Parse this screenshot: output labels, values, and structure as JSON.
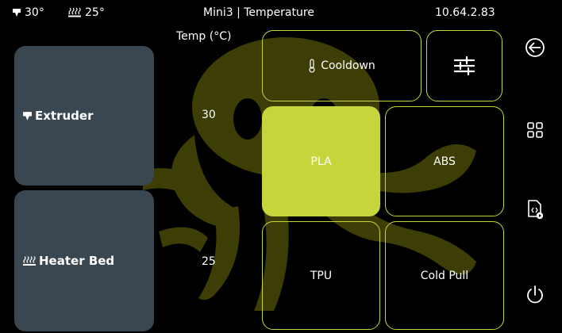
{
  "topbar": {
    "extruder_temp": "30°",
    "bed_temp": "25°",
    "title": "Mini3 | Temperature",
    "ip": "10.64.2.83"
  },
  "heaters": {
    "column_header": "Temp (°C)",
    "extruder": {
      "label": "Extruder",
      "temp": "30",
      "icon": "extruder-icon"
    },
    "heater_bed": {
      "label": "Heater Bed",
      "temp": "25",
      "icon": "heater-bed-icon"
    }
  },
  "presets": {
    "cooldown": "Cooldown",
    "pla": "PLA",
    "abs": "ABS",
    "tpu": "TPU",
    "cold_pull": "Cold Pull",
    "active": "PLA"
  },
  "nav": {
    "icons": [
      "back-icon",
      "menu-grid-icon",
      "file-icon",
      "power-icon"
    ]
  },
  "colors": {
    "accent": "#c5d63d",
    "panel": "#3a4751",
    "background": "#000000",
    "logo": "#3d3e05"
  }
}
